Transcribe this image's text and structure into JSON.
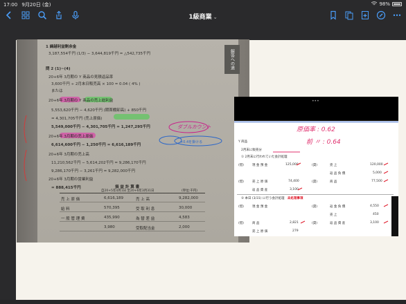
{
  "status_bar": {
    "time": "17:00",
    "date": "9月20日 (金)",
    "battery": "98%"
  },
  "toolbar": {
    "title": "1級商業",
    "left_icons": [
      "back-icon",
      "thumbnails-icon",
      "search-icon",
      "share-icon",
      "mic-icon"
    ],
    "right_icons": [
      "bookmark-icon",
      "pages-icon",
      "add-page-icon",
      "pen-icon",
      "more-icon"
    ]
  },
  "photo": {
    "side_tab": "解答への道",
    "items": [
      "1 繰越利益剰余金",
      "3,187,554千円 (1/3) − 3,644,819千円 = △542,735千円",
      "問 2 (1)~(4)",
      "20+6年 3月期の Y 商品の見積返品率",
      "3,600千円 ÷ 2月末日販売高 × 100 = 0.04 ( 4% )",
      "または",
      "20+6年 3月期の Y 商品の売上総利益",
      "5,553,620千円 − 4,620千円 (期首棚卸高) + 850千円",
      "= 4,301,705千円 (売上原価)",
      "5,549,000千円 − 4,301,705千円 = 1,247,295千円",
      "20+6年 3月期の売上原価",
      "6,614,600千円 − 1,250千円 = 6,616,189千円",
      "20+6年 3月期の売上高",
      "11,210,562千円 − 5,614,202千円 = 9,286,170千円",
      "9,286,170千円 − 3,261千円 = 9,282,000千円",
      "20+6年 3月期の営業利益",
      "= 888,415千円"
    ],
    "statement": {
      "title": "損 益 計 算 書",
      "period": "自20+5年4月1日 至20+6年3月31日",
      "unit": "(単位:千円)",
      "rows": [
        [
          "売 上 原 価",
          "6,616,189",
          "売 上 高",
          "9,282,000"
        ],
        [
          "給 料",
          "570,395",
          "受 取 利 息",
          "30,000"
        ],
        [
          "一 般 管 理 費",
          "435,990",
          "為 替 差 益",
          "4,583"
        ],
        [
          "",
          "3,980",
          "受取配当金",
          "2,000"
        ]
      ]
    },
    "annotations": [
      "ダブルカウント",
      "×0.4を掛ける"
    ]
  },
  "overlay": {
    "handwritten_1": "原価率 : 0.62",
    "handwritten_2": "前 〃 : 0.64",
    "header_item": "Y 商品",
    "date_line": "2月末に販売分",
    "section_1": "① 2月末に行われていた会計処理",
    "entries_1": [
      [
        "(借)",
        "現 金 預 金",
        "125,000",
        "(貸)",
        "売 上",
        "120,000"
      ],
      [
        "",
        "",
        "",
        "",
        "返 品 負 債",
        "5,000"
      ],
      [
        "(借)",
        "売 上 原 価",
        "74,400",
        "(貸)",
        "商 品",
        "77,500"
      ],
      [
        "",
        "返 品 資 産",
        "3,100",
        "",
        "",
        ""
      ]
    ],
    "section_2": "② 本日 (3/31) に行う会計処理",
    "section_2_note": "未処理事項",
    "entries_2": [
      [
        "(借)",
        "現 金 預 金",
        "",
        "(貸)",
        "返 金 負 債",
        "4,550"
      ],
      [
        "",
        "",
        "",
        "",
        "売 上",
        "450"
      ],
      [
        "(借)",
        "商 品",
        "2,821",
        "(貸)",
        "返 品 資 産",
        "3,100"
      ],
      [
        "",
        "売 上 原 価",
        "279",
        "",
        "",
        ""
      ]
    ]
  },
  "colors": {
    "accent": "#4a9df8",
    "page": "#f6f3ec",
    "chrome": "#2a2a2c",
    "pink": "#e0306e",
    "red": "#e01a2a"
  }
}
